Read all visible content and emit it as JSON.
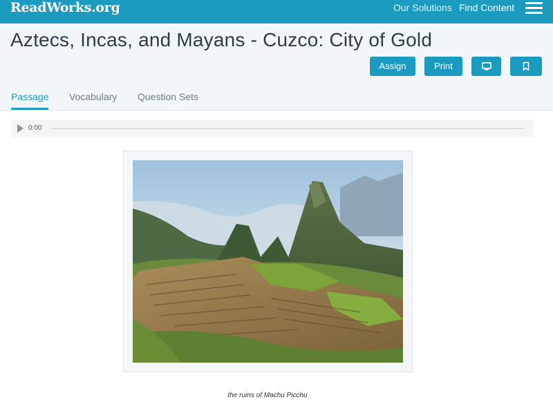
{
  "brand": {
    "logo_text": "ReadWorks.org"
  },
  "nav": {
    "our_solutions": "Our Solutions",
    "find_content": "Find Content",
    "menu_icon": "hamburger-menu-icon"
  },
  "header": {
    "title": "Aztecs, Incas, and Mayans - Cuzco: City of Gold",
    "buttons": {
      "assign": "Assign",
      "print": "Print",
      "present_icon": "monitor-icon",
      "bookmark_icon": "bookmark-icon"
    }
  },
  "tabs": [
    {
      "label": "Passage",
      "active": true
    },
    {
      "label": "Vocabulary",
      "active": false
    },
    {
      "label": "Question Sets",
      "active": false
    }
  ],
  "audio": {
    "time": "0:00",
    "play_icon": "play-icon"
  },
  "figure": {
    "image_description": "mountain-ruins-photo",
    "caption": "the ruins of Machu Picchu"
  },
  "colors": {
    "brand_blue": "#1a9bbf",
    "header_bg": "#f2f6f8",
    "title_text": "#2c3d47",
    "tab_inactive": "#6b7c85"
  }
}
